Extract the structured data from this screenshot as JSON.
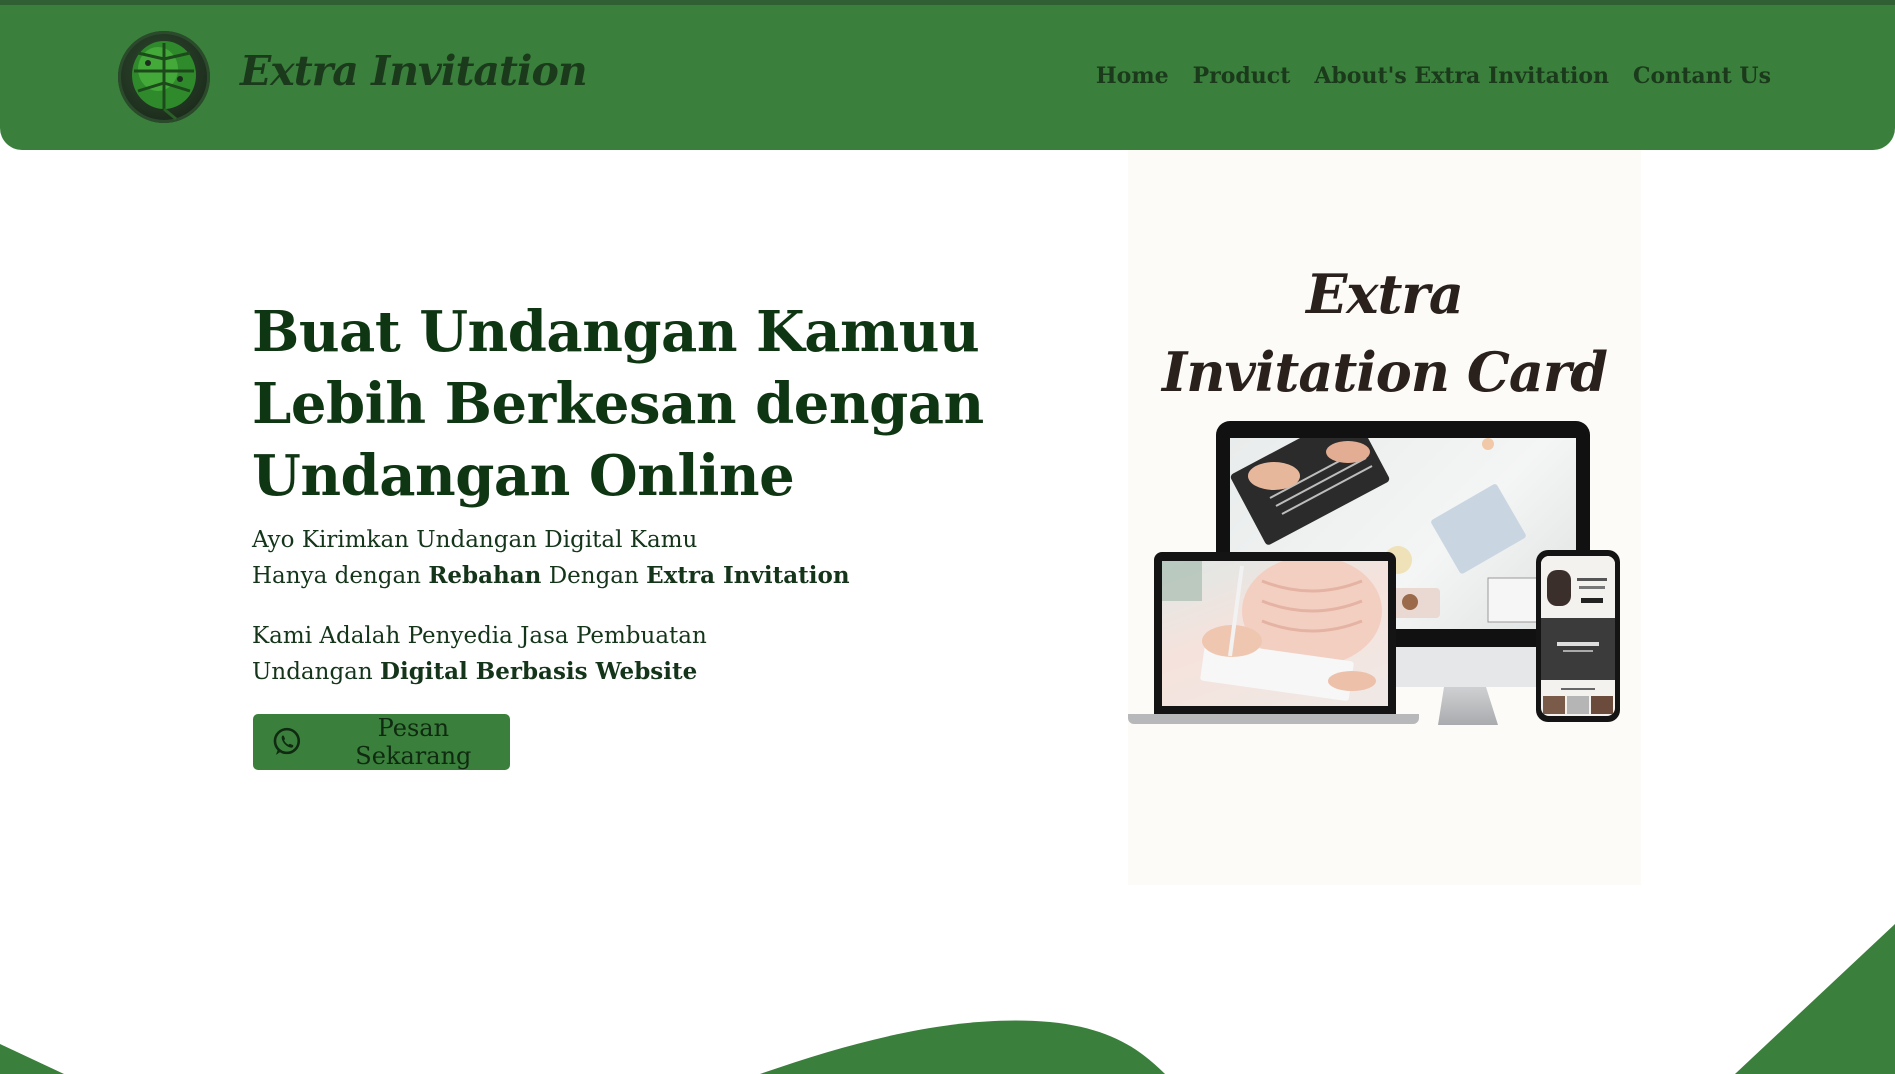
{
  "brand": {
    "name": "Extra Invitation",
    "logo_icon": "monstera-leaf-icon"
  },
  "nav": {
    "items": [
      {
        "label": "Home"
      },
      {
        "label": "Product"
      },
      {
        "label": "About's Extra Invitation"
      },
      {
        "label": "Contant Us"
      }
    ]
  },
  "hero": {
    "title_lines": [
      "Buat Undangan Kamuu",
      "Lebih Berkesan dengan",
      "Undangan Online"
    ],
    "p1": {
      "line1": "Ayo Kirimkan Undangan Digital Kamu",
      "line2_a": "Hanya dengan ",
      "line2_b": "Rebahan",
      "line2_c": " Dengan ",
      "line2_d": "Extra Invitation"
    },
    "p2": {
      "line1": "Kami Adalah Penyedia Jasa Pembuatan",
      "line2_a": "Undangan ",
      "line2_b": "Digital Berbasis Website"
    },
    "cta": {
      "label": "Pesan Sekarang",
      "icon": "whatsapp-icon"
    }
  },
  "card": {
    "title_line1": "Extra",
    "title_line2": "Invitation Card"
  },
  "colors": {
    "primary_green": "#3a7f3b",
    "dark_green_text": "#0f3612",
    "card_bg": "#fcfbf8"
  }
}
